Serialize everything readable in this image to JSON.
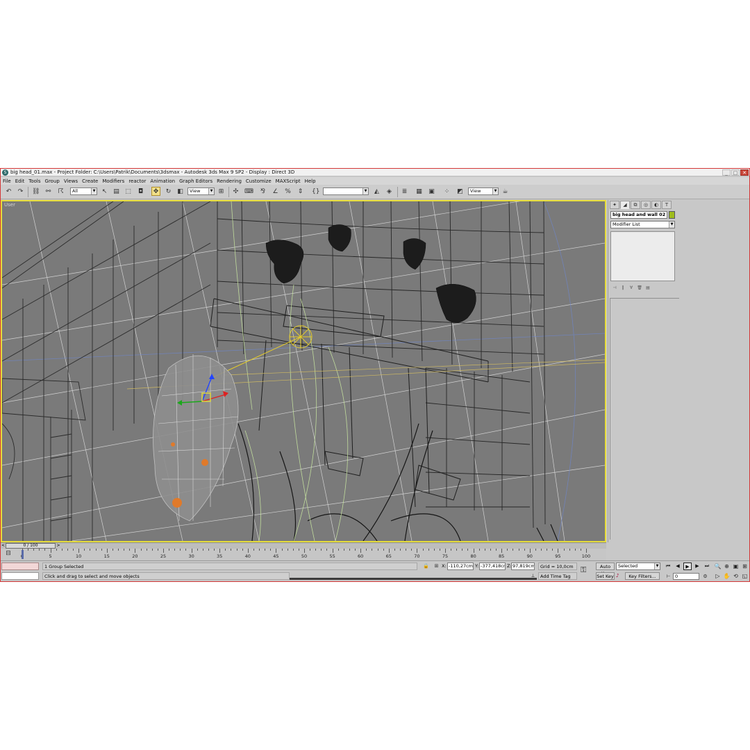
{
  "window": {
    "title": "big head_01.max    - Project Folder: C:\\Users\\Patrik\\Documents\\3dsmax    - Autodesk 3ds Max 9 SP2    - Display : Direct 3D",
    "min": "_",
    "max": "□",
    "close": "✕"
  },
  "menu": [
    "File",
    "Edit",
    "Tools",
    "Group",
    "Views",
    "Create",
    "Modifiers",
    "reactor",
    "Animation",
    "Graph Editors",
    "Rendering",
    "Customize",
    "MAXScript",
    "Help"
  ],
  "toolbar": {
    "selection_filter": "All",
    "ref_coord_system": "View",
    "named_selection": "",
    "render_view": "View"
  },
  "viewport": {
    "label": "User"
  },
  "command_panel": {
    "object_name": "big head and wall 02",
    "object_color": "#9fbc1c",
    "modifier_list": "Modifier List"
  },
  "time_slider": {
    "position_label": "0 / 100",
    "prev": "<",
    "next": ">"
  },
  "track_bar": {
    "ticks": [
      "0",
      "5",
      "10",
      "15",
      "20",
      "25",
      "30",
      "35",
      "40",
      "45",
      "50",
      "55",
      "60",
      "65",
      "70",
      "75",
      "80",
      "85",
      "90",
      "95",
      "100"
    ]
  },
  "status": {
    "selection": "1 Group Selected",
    "prompt": "Click and drag to select and move objects",
    "x_label": "X:",
    "x_value": "-110,27cm",
    "y_label": "Y:",
    "y_value": "-377,418cr",
    "z_label": "Z:",
    "z_value": "97,819cm",
    "grid": "Grid = 10,0cm",
    "add_time_tag": "Add Time Tag"
  },
  "animation": {
    "auto_key": "Auto Key",
    "set_key": "Set Key",
    "key_mode_selection": "Selected",
    "key_filters": "Key Filters...",
    "current_frame": "0"
  },
  "colors": {
    "viewport_bg": "#7a7a7a",
    "active_viewport_border": "#e6dc3a",
    "window_frame": "#d43838"
  }
}
